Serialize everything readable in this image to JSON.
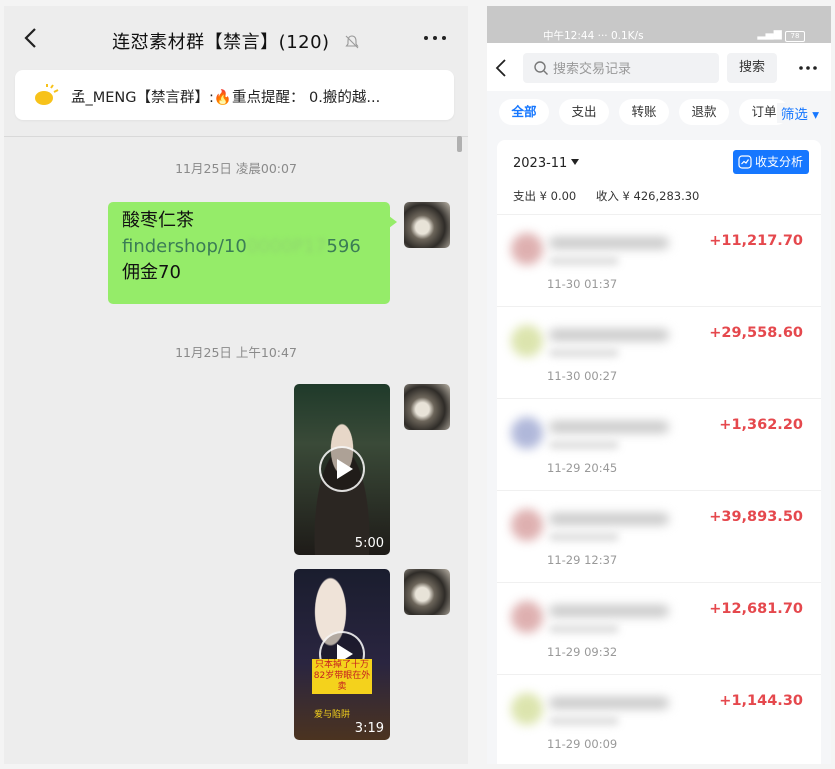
{
  "chat": {
    "title": "连怼素材群【禁言】(120)",
    "notice_text": "孟_MENG【禁言群】:🔥重点提醒： 0.搬的越...",
    "messages": [
      {
        "type": "time",
        "text": "11月25日 凌晨00:07"
      },
      {
        "type": "text",
        "line1": "酸枣仁茶",
        "link_head": "findershop/10",
        "link_blur": "0000P17",
        "link_tail": "596",
        "line3": "佣金70"
      },
      {
        "type": "time",
        "text": "11月25日 上午10:47"
      },
      {
        "type": "video",
        "duration": "5:00"
      },
      {
        "type": "video",
        "duration": "3:19",
        "caption_a": "只本掉了十万",
        "caption_b": "82岁带眼在外卖",
        "caption_c": "爱与陷阱"
      }
    ]
  },
  "phone": {
    "status_time": "中午12:44",
    "status_speed": "··· 0.1K/s",
    "battery": "78",
    "search_placeholder": "搜索交易记录",
    "search_button": "搜索",
    "filters": [
      "全部",
      "支出",
      "转账",
      "退款",
      "订单"
    ],
    "filter_button": "筛选 ▾",
    "month": "2023-11",
    "analysis_button": "收支分析",
    "expense_summary": "支出 ¥ 0.00",
    "income_summary": "收入 ¥ 426,283.30",
    "transactions": [
      {
        "amount": "+11,217.70",
        "time": "11-30 01:37",
        "icon_color": "#d9a3a3"
      },
      {
        "amount": "+29,558.60",
        "time": "11-30 00:27",
        "icon_color": "#d6e0a0"
      },
      {
        "amount": "+1,362.20",
        "time": "11-29 20:45",
        "icon_color": "#a3acd4"
      },
      {
        "amount": "+39,893.50",
        "time": "11-29 12:37",
        "icon_color": "#d9a3a3"
      },
      {
        "amount": "+12,681.70",
        "time": "11-29 09:32",
        "icon_color": "#d9a3a3"
      },
      {
        "amount": "+1,144.30",
        "time": "11-29 00:09",
        "icon_color": "#d6e0a0"
      }
    ]
  }
}
